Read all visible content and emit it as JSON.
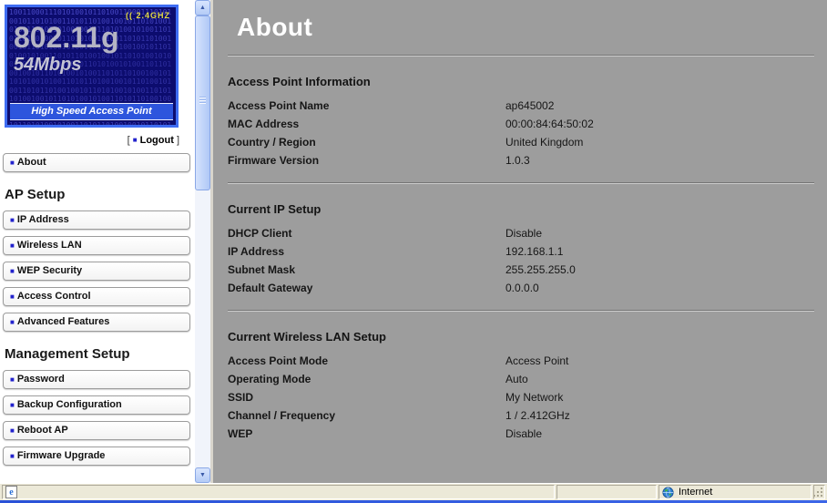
{
  "icons": {
    "bullet": "■",
    "arrow_up": "▲",
    "arrow_down": "▼",
    "browser_page": "e"
  },
  "colors": {
    "accent_blue": "#2d55dd",
    "content_bg": "#9d9d9d",
    "logo_border": "#3e6cf2",
    "logo_bg": "#0c0c6e",
    "freq_yellow": "#e4da43"
  },
  "logo": {
    "freq_label": "(( 2.4GHZ",
    "standard": "802.11g",
    "speed": "54Mbps",
    "tagline": "High Speed Access Point",
    "binary_pattern": "1001100011101010010110100110001110101001011010100110101101001001011010100101001101011010010010110101001010011010110100100101101010010100110101101001001011010100101001101011010010010110101001010011010110100100101101010010100110101101001001011010100101001101101001001011010100101001101011010010010110101001010011010110100100101101001010011010110100100101101010010100110101101001001011010100101001101011010010010110101101001001011010100101001101011010010010110101001010011010110100100101101010010100110101101001001011010100101001101011010010110101001010011010110100101101"
  },
  "sidebar": {
    "logout": {
      "open": "[",
      "label": "Logout",
      "close": "]"
    },
    "about": {
      "label": "About"
    },
    "sections": [
      {
        "heading": "AP Setup",
        "items": [
          {
            "label": "IP Address"
          },
          {
            "label": "Wireless LAN"
          },
          {
            "label": "WEP Security"
          },
          {
            "label": "Access Control"
          },
          {
            "label": "Advanced Features"
          }
        ]
      },
      {
        "heading": "Management Setup",
        "items": [
          {
            "label": "Password"
          },
          {
            "label": "Backup Configuration"
          },
          {
            "label": "Reboot AP"
          },
          {
            "label": "Firmware Upgrade"
          }
        ]
      }
    ]
  },
  "main": {
    "title": "About",
    "sections": [
      {
        "heading": "Access Point Information",
        "rows": [
          {
            "label": "Access Point Name",
            "value": "ap645002"
          },
          {
            "label": "MAC Address",
            "value": "00:00:84:64:50:02"
          },
          {
            "label": "Country / Region",
            "value": "United Kingdom"
          },
          {
            "label": "Firmware Version",
            "value": "1.0.3"
          }
        ]
      },
      {
        "heading": "Current IP Setup",
        "rows": [
          {
            "label": "DHCP Client",
            "value": "Disable"
          },
          {
            "label": "IP Address",
            "value": "192.168.1.1"
          },
          {
            "label": "Subnet Mask",
            "value": "255.255.255.0"
          },
          {
            "label": "Default Gateway",
            "value": "0.0.0.0"
          }
        ]
      },
      {
        "heading": "Current Wireless LAN Setup",
        "rows": [
          {
            "label": "Access Point Mode",
            "value": "Access Point"
          },
          {
            "label": "Operating Mode",
            "value": "Auto"
          },
          {
            "label": "SSID",
            "value": "My Network"
          },
          {
            "label": "Channel / Frequency",
            "value": "1 / 2.412GHz"
          },
          {
            "label": "WEP",
            "value": "Disable"
          }
        ]
      }
    ]
  },
  "statusbar": {
    "zone_label": "Internet"
  }
}
